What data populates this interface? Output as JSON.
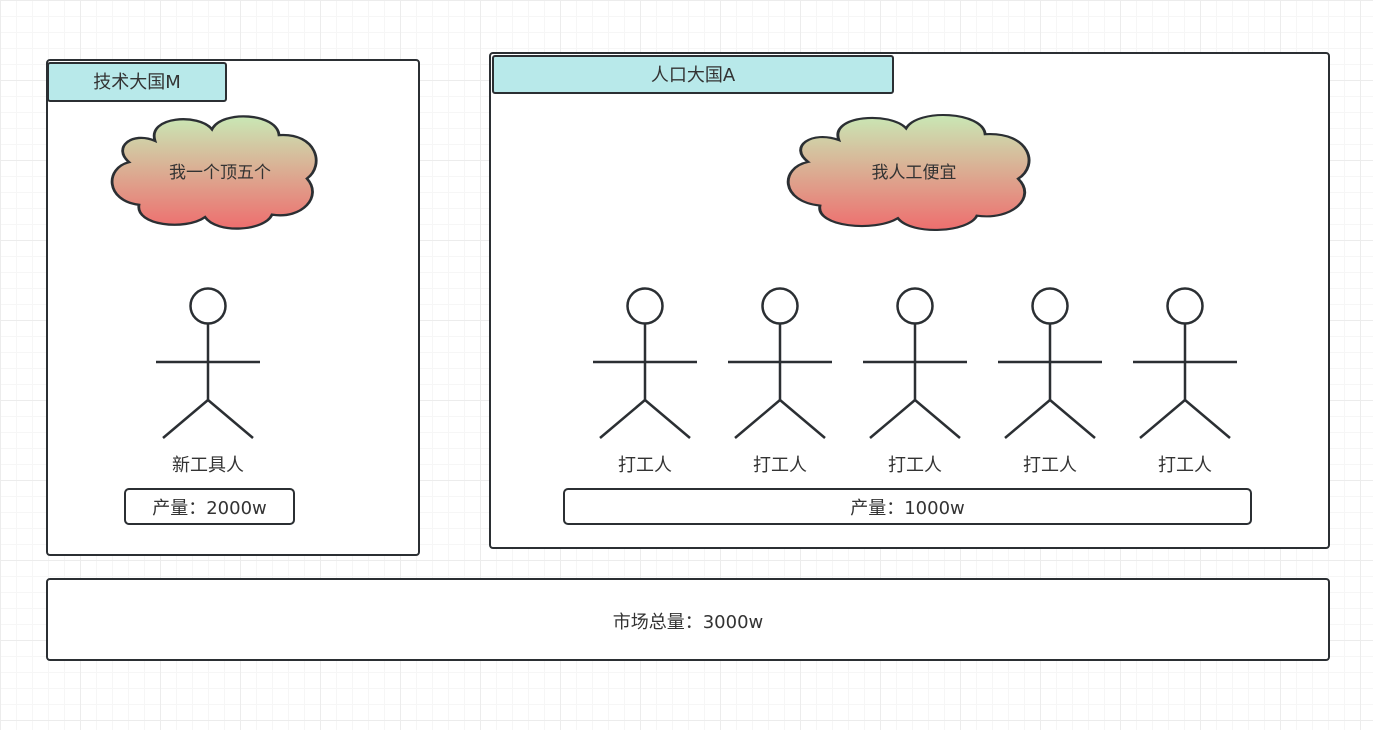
{
  "tech_country": {
    "title": "技术大国M",
    "cloud_text": "我一个顶五个",
    "actor_label": "新工具人",
    "output": "产量：2000w"
  },
  "population_country": {
    "title": "人口大国A",
    "cloud_text": "我人工便宜",
    "actors": [
      {
        "label": "打工人"
      },
      {
        "label": "打工人"
      },
      {
        "label": "打工人"
      },
      {
        "label": "打工人"
      },
      {
        "label": "打工人"
      }
    ],
    "output": "产量：1000w"
  },
  "market": {
    "total": "市场总量：3000w"
  },
  "colors": {
    "stroke": "#2b2f33",
    "tab_fill": "#b8e9ea",
    "cloud_top": "#c9e8b5",
    "cloud_bottom": "#ee6e6e"
  }
}
